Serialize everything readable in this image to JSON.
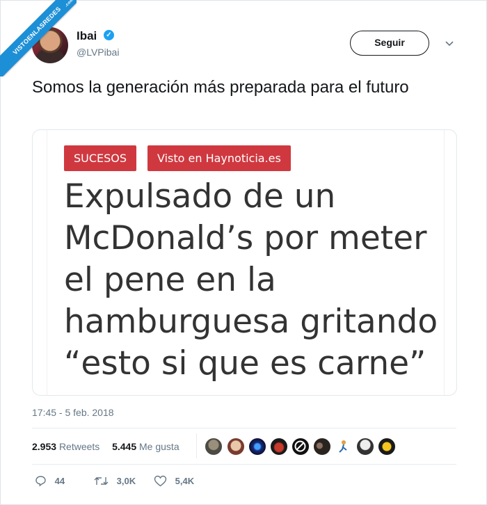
{
  "watermark": {
    "text": "VISTOENLASREDES",
    "sub": ".com"
  },
  "author": {
    "name": "Ibai",
    "handle": "@LVPibai"
  },
  "follow_label": "Seguir",
  "tweet": {
    "text": "Somos la generación más preparada para el futuro"
  },
  "card": {
    "tags": [
      "SUCESOS",
      "Visto en Haynoticia.es"
    ],
    "headline": "Expulsado de un McDonald’s por meter el pene en la hamburguesa gritando “esto si que es carne”"
  },
  "timestamp": "17:45 - 5 feb. 2018",
  "stats": {
    "retweets_count": "2.953",
    "retweets_label": "Retweets",
    "likes_count": "5.445",
    "likes_label": "Me gusta"
  },
  "actions": {
    "replies": "44",
    "retweets": "3,0K",
    "likes": "5,4K"
  },
  "colors": {
    "badge": "#d0383f",
    "verified": "#1da1f2",
    "ribbon": "#1d8fd6"
  }
}
